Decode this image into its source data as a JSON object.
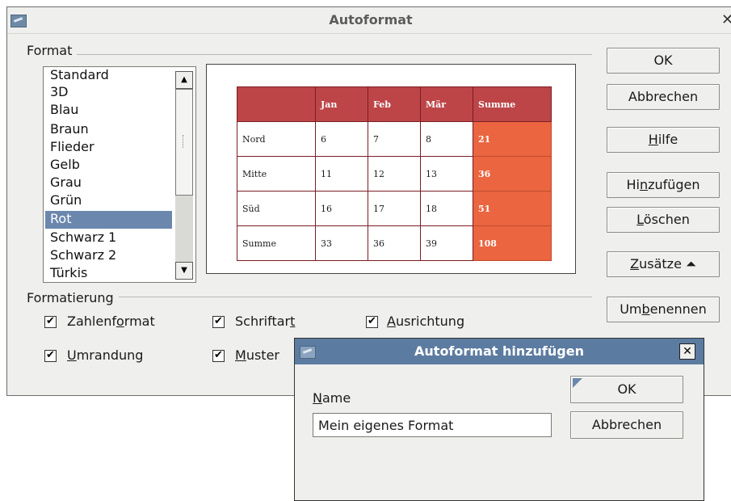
{
  "main_dialog": {
    "title": "Autoformat",
    "close_symbol": "✕",
    "format_group_label": "Format",
    "format_list": {
      "items": [
        "Standard",
        "3D",
        "Blau",
        "Braun",
        "Flieder",
        "Gelb",
        "Grau",
        "Grün",
        "Rot",
        "Schwarz 1",
        "Schwarz 2",
        "Türkis"
      ],
      "selected": "Rot"
    },
    "preview_table": {
      "header": [
        "",
        "Jan",
        "Feb",
        "Mär",
        "Summe"
      ],
      "rows": [
        [
          "Nord",
          "6",
          "7",
          "8",
          "21"
        ],
        [
          "Mitte",
          "11",
          "12",
          "13",
          "36"
        ],
        [
          "Süd",
          "16",
          "17",
          "18",
          "51"
        ],
        [
          "Summe",
          "33",
          "36",
          "39",
          "108"
        ]
      ],
      "colors": {
        "header": "#bd4548",
        "sum": "#ea6540",
        "border": "#7a1e24"
      }
    },
    "buttons": {
      "ok": "OK",
      "cancel": "Abbrechen",
      "help_mnemonic": "H",
      "help_rest": "ilfe",
      "add_pre": "Hi",
      "add_mnemonic": "n",
      "add_post": "zufügen",
      "delete_mnemonic": "L",
      "delete_rest": "öschen",
      "more_mnemonic": "Z",
      "more_rest": "usätze",
      "more_arrow": "⏶",
      "rename_pre": "Um",
      "rename_mnemonic": "b",
      "rename_post": "enennen"
    },
    "formatting_group_label": "Formatierung",
    "checkboxes": [
      {
        "pre": "Zahlenf",
        "mnemonic": "o",
        "post": "rmat",
        "checked": true
      },
      {
        "pre": "Schriftar",
        "mnemonic": "t",
        "post": "",
        "checked": true
      },
      {
        "pre": "",
        "mnemonic": "A",
        "post": "usrichtung",
        "checked": true
      },
      {
        "pre": "",
        "mnemonic": "U",
        "post": "mrandung",
        "checked": true
      },
      {
        "pre": "",
        "mnemonic": "M",
        "post": "uster",
        "checked": true
      }
    ],
    "check_mark": "✔"
  },
  "add_dialog": {
    "title": "Autoformat hinzufügen",
    "close_symbol": "✕",
    "name_label_mnemonic": "N",
    "name_label_rest": "ame",
    "name_value": "Mein eigenes Format",
    "ok": "OK",
    "cancel": "Abbrechen"
  },
  "colors": {
    "dialog_bg": "#efefed",
    "selection": "#6b87ad",
    "active_titlebar": "#5c7ba0"
  }
}
